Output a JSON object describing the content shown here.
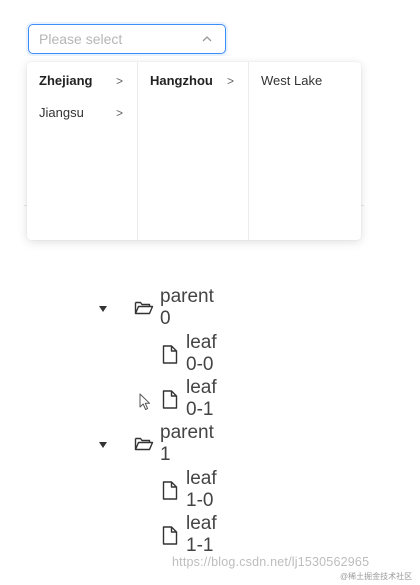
{
  "cascader": {
    "placeholder": "Please select",
    "menus": [
      [
        {
          "label": "Zhejiang",
          "active": true,
          "has_children": true
        },
        {
          "label": "Jiangsu",
          "active": false,
          "has_children": true
        }
      ],
      [
        {
          "label": "Hangzhou",
          "active": true,
          "has_children": true
        }
      ],
      [
        {
          "label": "West Lake",
          "active": false,
          "has_children": false
        }
      ]
    ],
    "chevron_glyph": ">"
  },
  "tree": {
    "nodes": [
      {
        "label": "parent 0",
        "type": "folder",
        "expanded": true
      },
      {
        "label": "leaf 0-0",
        "type": "file"
      },
      {
        "label": "leaf 0-1",
        "type": "file"
      },
      {
        "label": "parent 1",
        "type": "folder",
        "expanded": true
      },
      {
        "label": "leaf 1-0",
        "type": "file"
      },
      {
        "label": "leaf 1-1",
        "type": "file"
      }
    ]
  },
  "watermark": {
    "url_text": "https://blog.csdn.net/lj1530562965",
    "site_text": "@稀土掘金技术社区"
  },
  "colors": {
    "accent": "#3e8ef7",
    "text": "#333333",
    "placeholder": "#b6b6b6"
  }
}
